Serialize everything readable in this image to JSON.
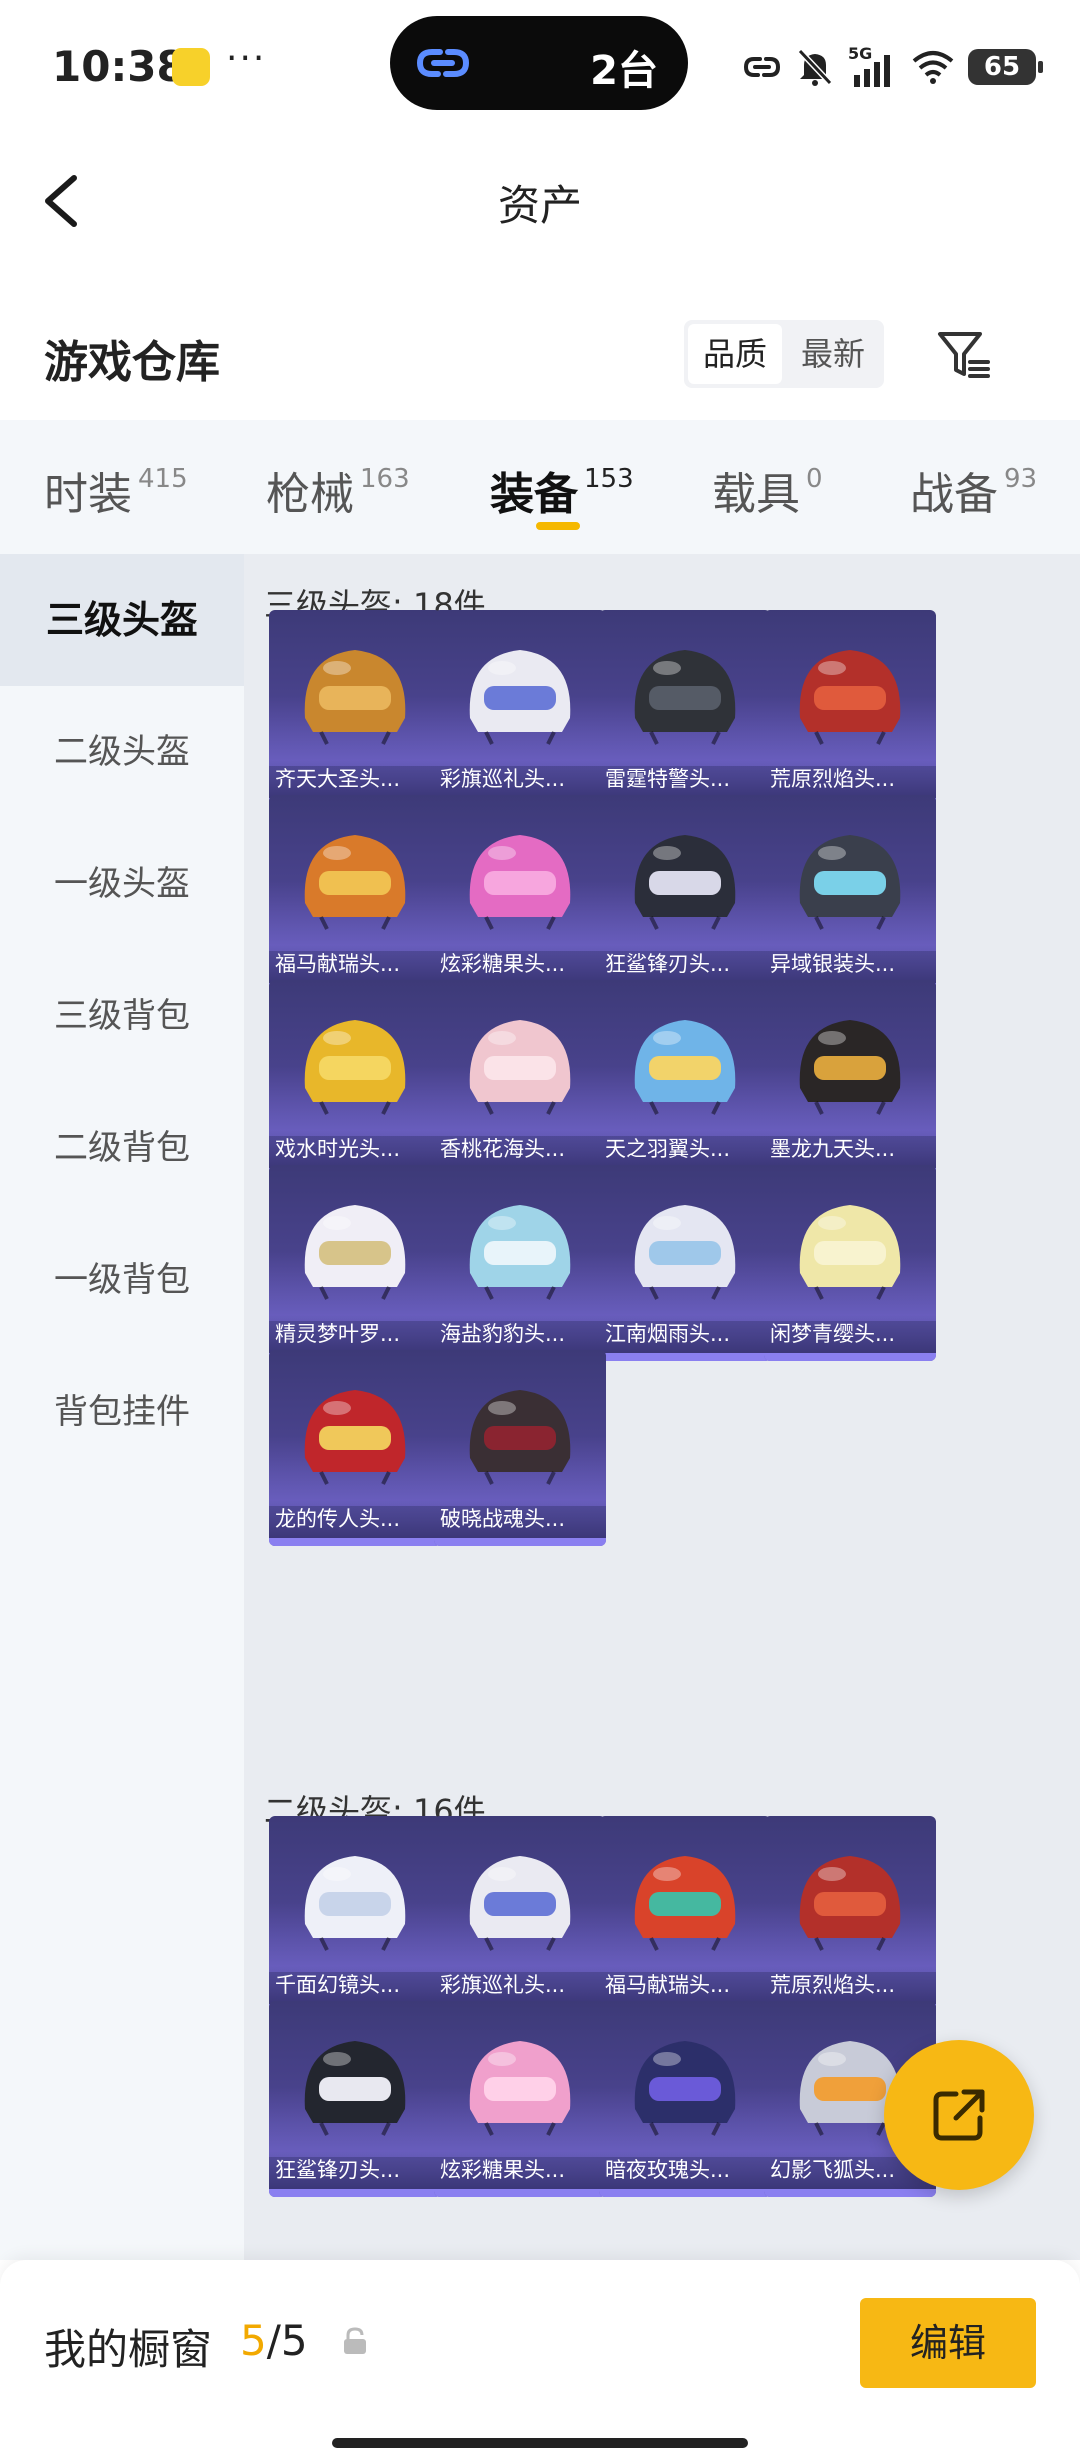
{
  "status_bar": {
    "time": "10:38",
    "dots": "···",
    "island_text": "2台",
    "network": "5G",
    "battery": "65",
    "icons": [
      "link-icon",
      "mute-bell-icon",
      "signal-icon",
      "wifi-icon",
      "battery-icon"
    ]
  },
  "nav": {
    "title": "资产",
    "back_icon": "chevron-left-icon"
  },
  "warehouse": {
    "title": "游戏仓库",
    "sort_options": [
      "品质",
      "最新"
    ],
    "sort_selected": "品质",
    "filter_icon": "filter-icon"
  },
  "categories": [
    {
      "label": "时装",
      "count": "415"
    },
    {
      "label": "枪械",
      "count": "163"
    },
    {
      "label": "装备",
      "count": "153"
    },
    {
      "label": "载具",
      "count": "0"
    },
    {
      "label": "战备",
      "count": "93"
    }
  ],
  "active_category": "装备",
  "sidebar": {
    "items": [
      "三级头盔",
      "二级头盔",
      "一级头盔",
      "三级背包",
      "二级背包",
      "一级背包",
      "背包挂件"
    ],
    "active": "三级头盔"
  },
  "sections": [
    {
      "title": "三级头盔: 18件",
      "items": [
        {
          "name": "齐天大圣头...",
          "color": "#c9872e",
          "accent": "#e8b45a"
        },
        {
          "name": "彩旗巡礼头...",
          "color": "#eaeaf2",
          "accent": "#6b7bd8"
        },
        {
          "name": "雷霆特警头...",
          "color": "#2f3238",
          "accent": "#555b66"
        },
        {
          "name": "荒原烈焰头...",
          "color": "#b3302a",
          "accent": "#e05a3c"
        },
        {
          "name": "福马献瑞头...",
          "color": "#d97a2a",
          "accent": "#f0c050"
        },
        {
          "name": "炫彩糖果头...",
          "color": "#e46bc3",
          "accent": "#f7a6de"
        },
        {
          "name": "狂鲨锋刃头...",
          "color": "#2b2e3a",
          "accent": "#d8d8e8"
        },
        {
          "name": "异域银装头...",
          "color": "#3a3f4c",
          "accent": "#7ad0e8"
        },
        {
          "name": "戏水时光头...",
          "color": "#e8b72a",
          "accent": "#f5d660"
        },
        {
          "name": "香桃花海头...",
          "color": "#f0c6cf",
          "accent": "#fbe3e8"
        },
        {
          "name": "天之羽翼头...",
          "color": "#6fb4e8",
          "accent": "#f2d36a"
        },
        {
          "name": "墨龙九天头...",
          "color": "#2a2626",
          "accent": "#d9a23c"
        },
        {
          "name": "精灵梦叶罗...",
          "color": "#f0eef6",
          "accent": "#d7c48a"
        },
        {
          "name": "海盐豹豹头...",
          "color": "#9fd4e8",
          "accent": "#e8f4fa"
        },
        {
          "name": "江南烟雨头...",
          "color": "#e4e6f2",
          "accent": "#9fc8ea"
        },
        {
          "name": "闲梦青缨头...",
          "color": "#efe7a8",
          "accent": "#f8f3cf"
        },
        {
          "name": "龙的传人头...",
          "color": "#c0262b",
          "accent": "#f0c85a"
        },
        {
          "name": "破晓战魂头...",
          "color": "#3a2f34",
          "accent": "#8a2430"
        }
      ]
    },
    {
      "title": "二级头盔: 16件",
      "items": [
        {
          "name": "千面幻镜头...",
          "color": "#eef0f8",
          "accent": "#c8d4ea"
        },
        {
          "name": "彩旗巡礼头...",
          "color": "#eaeaf2",
          "accent": "#6b7bd8"
        },
        {
          "name": "福马献瑞头...",
          "color": "#d9432a",
          "accent": "#45b8a0"
        },
        {
          "name": "荒原烈焰头...",
          "color": "#b3302a",
          "accent": "#e05a3c"
        },
        {
          "name": "狂鲨锋刃头...",
          "color": "#23262f",
          "accent": "#e8e8f0"
        },
        {
          "name": "炫彩糖果头...",
          "color": "#f0a0cc",
          "accent": "#ffd0e8"
        },
        {
          "name": "暗夜玫瑰头...",
          "color": "#2c2f6a",
          "accent": "#6a5ad8"
        },
        {
          "name": "幻影飞狐头...",
          "color": "#c8cbd8",
          "accent": "#f0a03a"
        }
      ]
    }
  ],
  "showcase": {
    "label": "我的橱窗",
    "current": "5",
    "separator": "/",
    "total": "5"
  },
  "edit_button": "编辑",
  "fab_icon": "share-icon",
  "colors": {
    "accent": "#f7b814",
    "card_top": "#3d3a78",
    "card_bottom": "#5a54a8",
    "sidebar_bg": "#f4f7fa"
  }
}
